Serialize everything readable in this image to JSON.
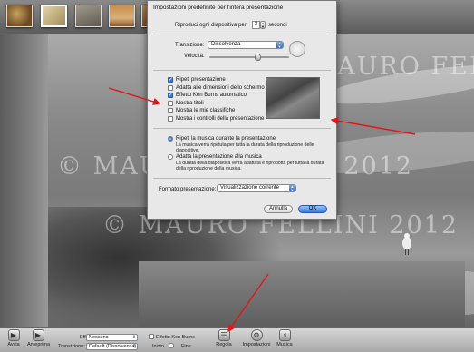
{
  "dialog": {
    "title": "Impostazioni predefinite per l'intera presentazione",
    "play_each_label": "Riproduci ogni diapositiva per",
    "seconds_value": "3",
    "seconds_label": "secondi",
    "transition_label": "Transizione:",
    "transition_value": "Dissolvenza",
    "speed_label": "Velocità:",
    "speed_level": 0.6,
    "options": [
      {
        "label": "Ripeti presentazione",
        "checked": true
      },
      {
        "label": "Adatta alle dimensioni dello schermo",
        "checked": false
      },
      {
        "label": "Effetto Ken Burns automatico",
        "checked": true
      },
      {
        "label": "Mostra titoli",
        "checked": false
      },
      {
        "label": "Mostra le mie classifiche",
        "checked": false
      },
      {
        "label": "Mostra i controlli della presentazione",
        "checked": false
      }
    ],
    "music_repeat_label": "Ripeti la musica durante la presentazione",
    "music_repeat_desc": "La musica verrà ripetuta per tutta la durata della riproduzione delle diapositive.",
    "music_fit_label": "Adatta la presentazione alla musica",
    "music_fit_desc": "La durata della diapositiva verrà adattata e riprodotta per tutta la durata della riproduzione della musica.",
    "format_label": "Formato presentazione:",
    "format_value": "Visualizzazione corrente",
    "cancel_label": "Annulla",
    "ok_label": "OK"
  },
  "watermark": {
    "text": "© MAURO FELLINI 2012"
  },
  "toolbar": {
    "play_label": "Avvia",
    "preview_label": "Anteprima",
    "effect_label": "Effetto:",
    "effect_value": "Nessuno",
    "transition_label": "Transizione:",
    "transition_value": "Default (Dissolvenza)",
    "kenburns_label": "Effetto Ken Burns",
    "start_label": "Inizio",
    "end_label": "Fine",
    "settings_label": "Regola",
    "setup_label": "Impostazioni",
    "music_label": "Musica"
  },
  "colors": {
    "accent": "#3b78d8",
    "arrow": "#e0161b"
  }
}
